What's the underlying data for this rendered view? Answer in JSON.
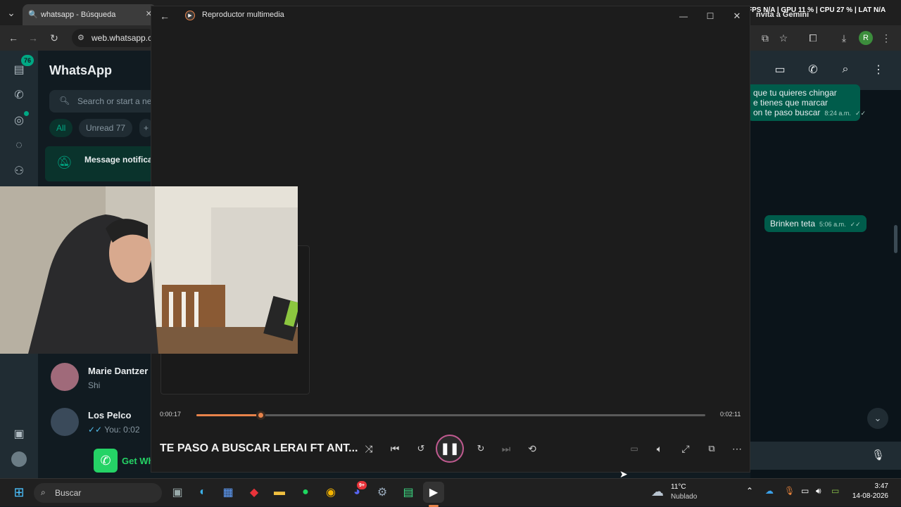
{
  "browser": {
    "tab_title": "whatsapp - Búsqueda",
    "url": "web.whatsapp.c",
    "profile_initial": "R"
  },
  "overlay_stats": "FPS N/A | GPU 11 % | CPU 27 % | LAT N/A",
  "gemini_text": "nvita a Gemini",
  "whatsapp": {
    "title": "WhatsApp",
    "chats_badge": "76",
    "search_placeholder": "Search or start a ne",
    "filters": [
      "All",
      "Unread 77"
    ],
    "filter_add": "+",
    "notification_text": "Message notificat",
    "chats": [
      {
        "name": "Marie Dantzer",
        "preview": "Shi"
      },
      {
        "name": "Los Pelco",
        "preview": "You: 0:02"
      }
    ],
    "get_app_text": "Get Wh",
    "messages": [
      {
        "lines": [
          "que tu quieres chingar",
          "e tienes que marcar",
          "on te paso buscar"
        ],
        "time": "8:24 a.m."
      },
      {
        "lines": [
          "Brinken teta"
        ],
        "time": "5:06 a.m."
      }
    ]
  },
  "player": {
    "app_title": "Reproductor multimedia",
    "elapsed": "0:00:17",
    "total": "0:02:11",
    "progress": 0.126,
    "track_title": "TE PASO A BUSCAR LERAI FT ANT..."
  },
  "taskbar": {
    "search_placeholder": "Buscar",
    "weather_temp": "11°C",
    "weather_desc": "Nublado",
    "time": "3:47",
    "date": "14-08-2026",
    "discord_badge": "9+"
  },
  "colors": {
    "whatsapp_green": "#00a884",
    "player_accent": "#e8834a",
    "bubble_out": "#005c4b"
  }
}
